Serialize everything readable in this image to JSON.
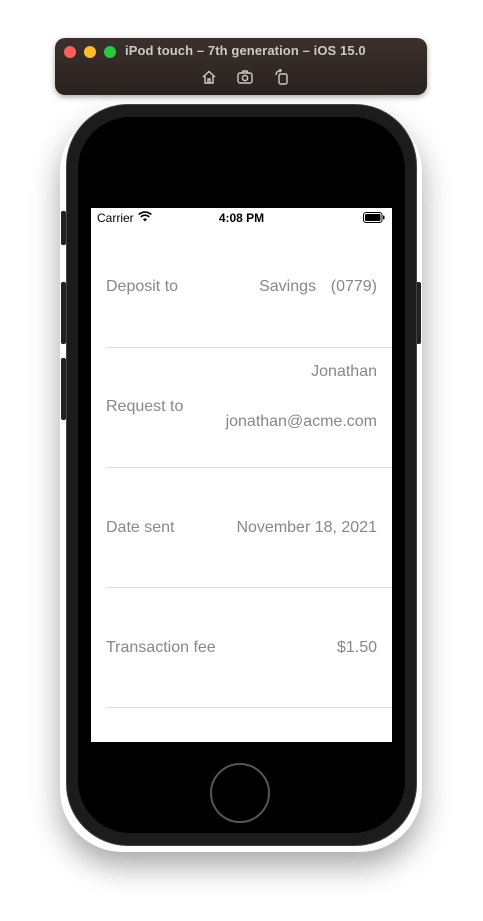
{
  "simulator": {
    "title": "iPod touch – 7th generation – iOS 15.0",
    "tools": [
      "home-icon",
      "screenshot-icon",
      "rotate-icon"
    ]
  },
  "status_bar": {
    "carrier": "Carrier",
    "time": "4:08 PM"
  },
  "details": {
    "deposit": {
      "label": "Deposit to",
      "account": "Savings",
      "account_number": "(0779)"
    },
    "request": {
      "label": "Request to",
      "name": "Jonathan",
      "email": "jonathan@acme.com"
    },
    "date": {
      "label": "Date sent",
      "value": "November 18, 2021"
    },
    "fee": {
      "label": "Transaction fee",
      "value": "$1.50"
    }
  },
  "colors": {
    "text_secondary": "#888888",
    "divider": "#e0e0e0"
  }
}
